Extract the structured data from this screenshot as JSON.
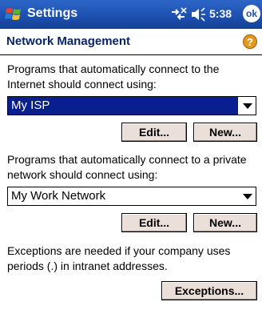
{
  "titlebar": {
    "app_title": "Settings",
    "clock": "5:38",
    "ok_label": "ok"
  },
  "header": {
    "title": "Network Management",
    "help_glyph": "?"
  },
  "internet": {
    "description": "Programs that automatically connect to the Internet should connect using:",
    "selected": "My ISP",
    "edit_label": "Edit...",
    "new_label": "New..."
  },
  "private": {
    "description": "Programs that automatically connect to a private network should connect using:",
    "selected": "My Work Network",
    "edit_label": "Edit...",
    "new_label": "New..."
  },
  "exceptions": {
    "description": "Exceptions are needed if your company uses periods (.) in intranet addresses.",
    "button_label": "Exceptions..."
  },
  "colors": {
    "titlebar": "#1c4fae",
    "header_text": "#0a246a",
    "selection": "#0a1f8f",
    "button_face": "#eadfd9"
  }
}
